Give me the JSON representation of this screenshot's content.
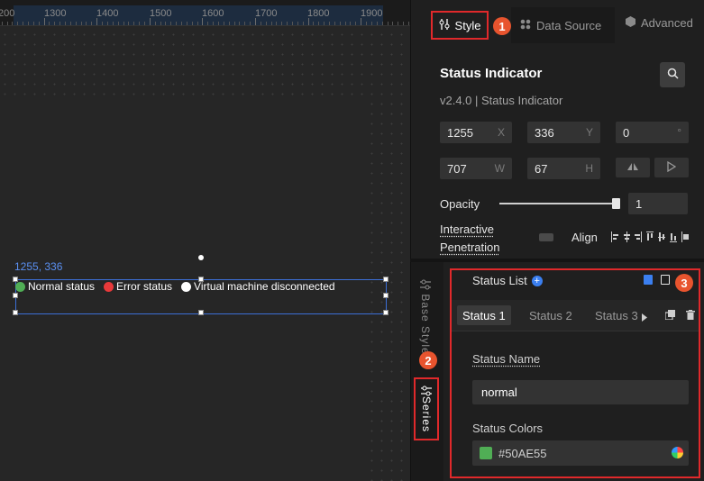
{
  "ruler": {
    "labels": [
      "200",
      "1300",
      "1400",
      "1500",
      "1600",
      "1700",
      "1800",
      "1900"
    ]
  },
  "canvas": {
    "coord_label": "1255, 336",
    "statuses": [
      {
        "label": "Normal status",
        "color": "#50AE55"
      },
      {
        "label": "Error status",
        "color": "#E8393A"
      },
      {
        "label": "Virtual machine disconnected",
        "color": "#FFFFFF"
      }
    ]
  },
  "tabs": {
    "style": "Style",
    "data_source": "Data Source",
    "advanced": "Advanced"
  },
  "badges": [
    "1",
    "2",
    "3"
  ],
  "component": {
    "title": "Status Indicator",
    "version": "v2.4.0 | Status Indicator"
  },
  "fields": {
    "x": {
      "value": "1255",
      "unit": "X"
    },
    "y": {
      "value": "336",
      "unit": "Y"
    },
    "rotation": {
      "value": "0",
      "unit": "°"
    },
    "width": {
      "value": "707",
      "unit": "W"
    },
    "height": {
      "value": "67",
      "unit": "H"
    }
  },
  "opacity": {
    "label": "Opacity",
    "value": "1",
    "level": 1
  },
  "interactive": {
    "label_line1": "Interactive",
    "label_line2": "Penetration"
  },
  "align": {
    "label": "Align"
  },
  "side_tabs": {
    "base_style": "Base Style",
    "series": "Series"
  },
  "series": {
    "title": "Status List",
    "subtabs": [
      "Status 1",
      "Status 2",
      "Status 3"
    ],
    "status_name_label": "Status Name",
    "status_name_value": "normal",
    "status_colors_label": "Status Colors",
    "status_color_value": "#50AE55"
  },
  "colors": {
    "accent": "#3B7FF0",
    "highlight_border": "#E0292B",
    "badge": "#E8542E"
  }
}
